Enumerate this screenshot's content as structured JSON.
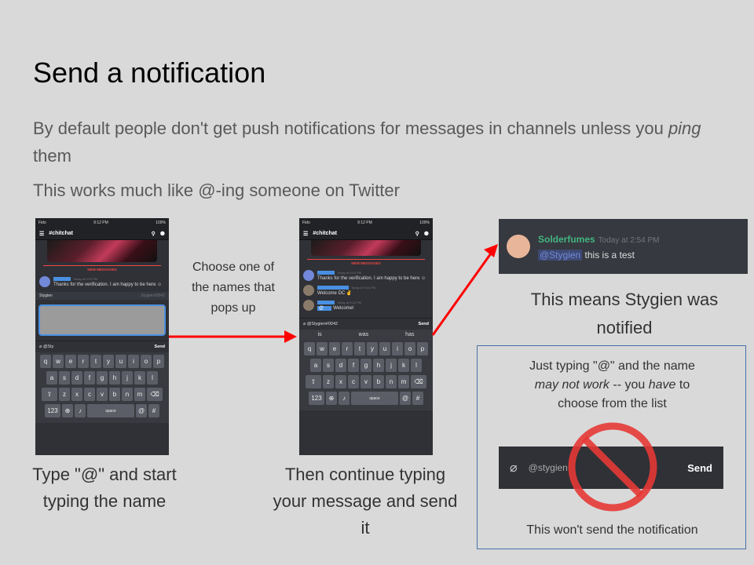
{
  "slide": {
    "title": "Send a notification",
    "sub1_a": "By default people don't get push notifications for messages in channels unless you ",
    "sub1_em": "ping",
    "sub1_b": " them",
    "sub2": "This works much like @-ing someone on Twitter"
  },
  "phone1": {
    "carrier": "Fido",
    "time": "9:12 PM",
    "battery": "100%",
    "channel": "#chitchat",
    "new_messages": "NEW MESSAGES",
    "msg_time": "Today at 9:10 PM",
    "msg_text": "Thanks for the verification. I am happy to be here",
    "suggest_user": "Stygien",
    "suggest_tag": "Stygien#0042",
    "input_value": "@Sty",
    "send": "Send",
    "kb_row1": [
      "q",
      "w",
      "e",
      "r",
      "t",
      "y",
      "u",
      "i",
      "o",
      "p"
    ],
    "kb_row2": [
      "a",
      "s",
      "d",
      "f",
      "g",
      "h",
      "j",
      "k",
      "l"
    ],
    "kb_row3": [
      "z",
      "x",
      "c",
      "v",
      "b",
      "n",
      "m"
    ],
    "kb_123": "123",
    "kb_space": "space",
    "kb_at": "@",
    "kb_hash": "#"
  },
  "phone2": {
    "carrier": "Fido",
    "time": "9:12 PM",
    "battery": "100%",
    "channel": "#chitchat",
    "new_messages": "NEW MESSAGES",
    "msg1_time": "Today at 9:10 PM",
    "msg1_text": "Thanks for the verification. I am happy to be here",
    "msg2_time": "Today at 9:10 PM",
    "msg2_text": "Welcome DC",
    "msg3_time": "Today at 9:12 PM",
    "msg3_text": "Welcome!",
    "input_value": "@Stygien#0042",
    "send": "Send",
    "suggestions": [
      "is",
      "was",
      "has"
    ],
    "kb_row1": [
      "q",
      "w",
      "e",
      "r",
      "t",
      "y",
      "u",
      "i",
      "o",
      "p"
    ],
    "kb_row2": [
      "a",
      "s",
      "d",
      "f",
      "g",
      "h",
      "j",
      "k",
      "l"
    ],
    "kb_row3": [
      "z",
      "x",
      "c",
      "v",
      "b",
      "n",
      "m"
    ],
    "kb_123": "123",
    "kb_space": "space",
    "kb_at": "@",
    "kb_hash": "#"
  },
  "captions": {
    "mid": "Choose one of the names that pops up",
    "cap1": "Type \"@\" and start typing the name",
    "cap2": "Then continue typing your message and send it",
    "cap3": "This means Stygien was notified"
  },
  "discord_msg": {
    "username": "Solderfumes",
    "time": "Today at 2:54 PM",
    "mention": "@Stygien",
    "text": " this is a test",
    "username_color": "#43b581"
  },
  "warning": {
    "line1": "Just typing \"@\" and the name",
    "em1": "may not work",
    "mid": " -- you ",
    "em2": "have",
    "tail": " to",
    "line3": "choose from the list",
    "input_value": "@stygien",
    "send": "Send",
    "bottom": "This won't send the notification"
  },
  "colors": {
    "arrow": "#ff0000",
    "prohibition": "#e53935",
    "discord_bg": "#36393f",
    "mention_blue": "#4a90e2"
  }
}
